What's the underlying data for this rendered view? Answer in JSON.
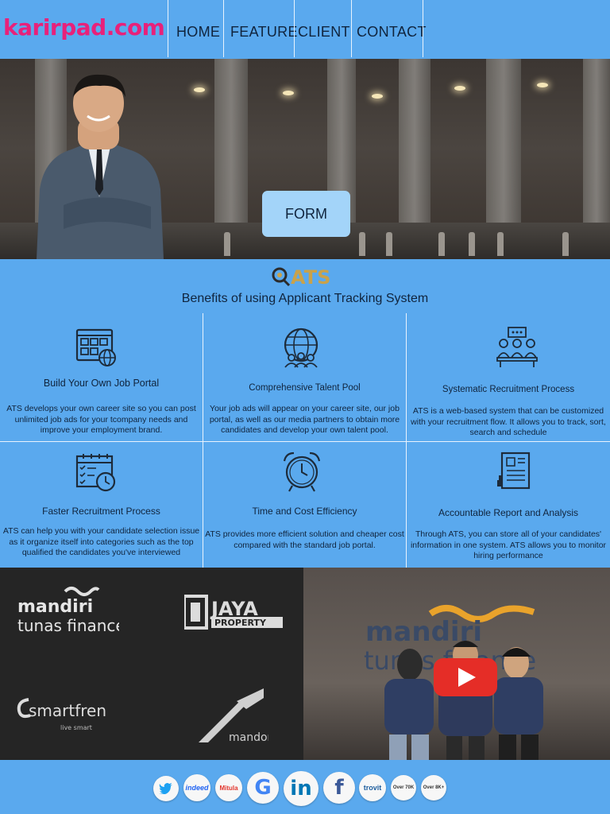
{
  "header": {
    "logo": "karirpad.com",
    "nav": [
      "HOME",
      "FEATURE",
      "CLIENT",
      "CONTACT"
    ]
  },
  "hero": {
    "button_label": "FORM"
  },
  "ats": {
    "logo_text": "ATS",
    "title": "Benefits of using Applicant Tracking System"
  },
  "features": [
    {
      "icon": "web-portal-icon",
      "title": "Build Your Own Job Portal",
      "desc": "ATS develops your own career site so you can post unlimited job ads for your tcompany needs and improve your employment brand."
    },
    {
      "icon": "globe-people-icon",
      "title": "Comprehensive Talent Pool",
      "desc": "Your job ads will appear on your career site, our job portal, as well as our media partners to obtain more candidates and develop your own talent pool."
    },
    {
      "icon": "meeting-icon",
      "title": "Systematic Recruitment Process",
      "desc": "ATS is a web-based system that can be customized with your recruitment flow. It allows you to track, sort, search and schedule"
    },
    {
      "icon": "calendar-clock-icon",
      "title": "Faster Recruitment Process",
      "desc": "ATS can help you with your candidate selection issue as it organize itself into categories such as the top qualified the candidates you've interviewed"
    },
    {
      "icon": "alarm-clock-icon",
      "title": "Time and Cost Efficiency",
      "desc": "ATS provides more efficient solution and cheaper cost compared with the standard job portal."
    },
    {
      "icon": "report-icon",
      "title": "Accountable Report and Analysis",
      "desc": "Through ATS, you can store all of your candidates' information in one system. ATS allows you to monitor hiring performance"
    }
  ],
  "clients": {
    "mandiri_line1": "mandiri",
    "mandiri_line2": "tunas finance",
    "jaya_line1": "JAYA",
    "jaya_line2": "PROPERTY",
    "smartfren": "smartfren",
    "smartfren_tag": "live smart",
    "mandom": "mandom"
  },
  "video": {
    "wall_line1": "mandiri",
    "wall_line2": "tunas finance"
  },
  "footer": {
    "icons": [
      "twitter-icon",
      "indeed-icon",
      "mitula-icon",
      "google-icon",
      "linkedin-icon",
      "facebook-icon",
      "trovit-icon",
      "partner-icon-1",
      "partner-icon-2"
    ],
    "indeed": "indeed",
    "mitula": "Mitula",
    "google": "G",
    "linkedin": "in",
    "facebook": "f",
    "trovit": "trovit",
    "partner1": "Over 70K",
    "partner2": "Over 8K+"
  },
  "colors": {
    "background": "#5aa9ee",
    "logo": "#e8217a",
    "button": "#a3d4f9",
    "ats_gold": "#c9a24a",
    "youtube_red": "#e52d27"
  }
}
